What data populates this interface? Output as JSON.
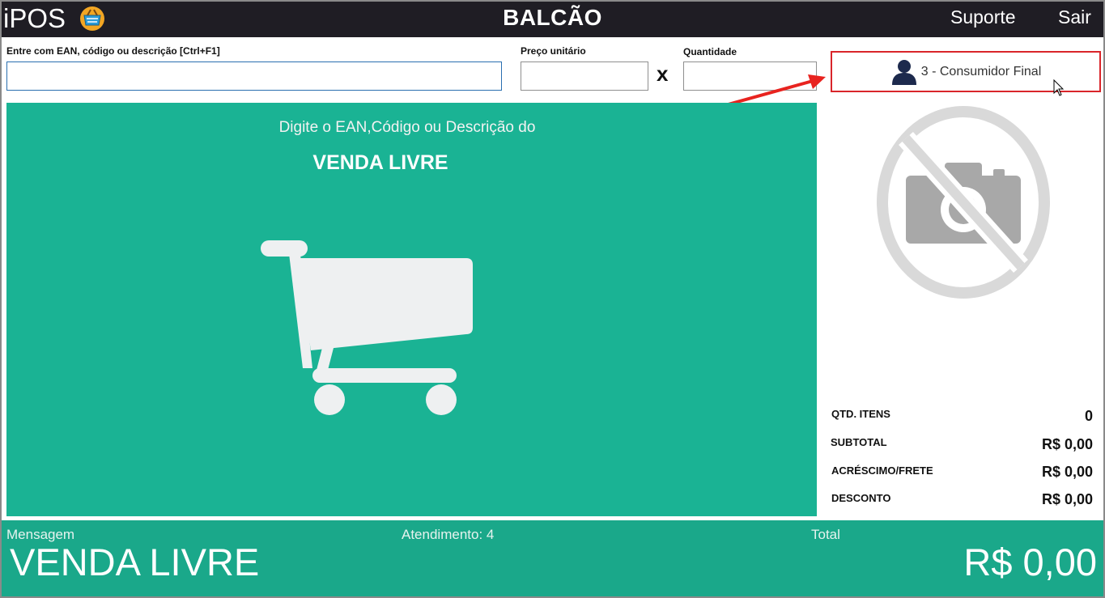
{
  "header": {
    "logo_text": "iPOS",
    "title": "BALCÃO",
    "suporte_label": "Suporte",
    "sair_label": "Sair"
  },
  "search": {
    "label": "Entre com EAN, código ou descrição [Ctrl+F1]",
    "value": "",
    "placeholder": ""
  },
  "price": {
    "label": "Preço unitário",
    "value": ""
  },
  "times_sign": "x",
  "quantity": {
    "label": "Quantidade",
    "value": ""
  },
  "customer": {
    "label": "3 - Consumidor Final"
  },
  "panel": {
    "prompt": "Digite o EAN,Código ou Descrição do",
    "heading": "VENDA LIVRE"
  },
  "summary": {
    "qtd_itens_label": "QTD. ITENS",
    "qtd_itens_value": "0",
    "subtotal_label": "SUBTOTAL",
    "subtotal_value": "R$ 0,00",
    "acrescimo_label": "ACRÉSCIMO/FRETE",
    "acrescimo_value": "R$ 0,00",
    "desconto_label": "DESCONTO",
    "desconto_value": "R$ 0,00"
  },
  "footer": {
    "mensagem_label": "Mensagem",
    "mensagem_value": "VENDA LIVRE",
    "atendimento_label": "Atendimento: 4",
    "total_label": "Total",
    "total_value": "R$ 0,00"
  },
  "colors": {
    "header_bg": "#1f1d24",
    "panel_bg": "#1ab394",
    "footer_bg": "#1aa88a",
    "customer_border": "#d9252a"
  },
  "icons": [
    "basket-icon",
    "user-icon",
    "cart-icon",
    "no-camera-icon",
    "arrow-icon",
    "mouse-cursor-icon"
  ]
}
